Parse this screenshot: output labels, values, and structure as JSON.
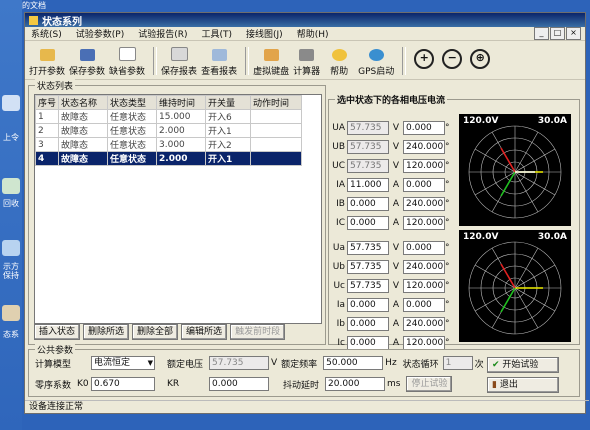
{
  "desktop": {
    "top_text": "的文档",
    "labels": [
      "上令",
      "回收",
      "示方保持",
      "态系"
    ]
  },
  "window": {
    "title": "状态系列",
    "controls": [
      "_",
      "□",
      "×"
    ]
  },
  "menu": [
    "系统(S)",
    "试验参数(P)",
    "试验报告(R)",
    "工具(T)",
    "接线图(J)",
    "帮助(H)"
  ],
  "toolbar": {
    "open": "打开参数",
    "save": "保存参数",
    "default": "缺省参数",
    "save_report": "保存报表",
    "view_report": "查看报表",
    "keyboard": "虚拟键盘",
    "calculator": "计算器",
    "help": "帮助",
    "gps": "GPS启动",
    "zoom_in": "+",
    "zoom_out": "−",
    "zoom_fit": "⊕"
  },
  "state_list": {
    "title": "状态列表",
    "headers": [
      "序号",
      "状态名称",
      "状态类型",
      "维持时间",
      "开关量",
      "动作时间"
    ],
    "rows": [
      [
        "1",
        "故障态",
        "任意状态",
        "15.000",
        "开入6",
        ""
      ],
      [
        "2",
        "故障态",
        "任意状态",
        "2.000",
        "开入1",
        ""
      ],
      [
        "3",
        "故障态",
        "任意状态",
        "3.000",
        "开入2",
        ""
      ],
      [
        "4",
        "故障态",
        "任意状态",
        "2.000",
        "开入1",
        ""
      ]
    ],
    "selected_index": 3,
    "buttons": [
      "插入状态",
      "删除所选",
      "删除全部",
      "编辑所选",
      "触发前时段"
    ]
  },
  "phasor": {
    "title": "选中状态下的各相电压电流",
    "set1": {
      "rows": [
        {
          "label": "UA",
          "mag": "57.735",
          "mag_unit": "V",
          "ang": "0.000",
          "ang_unit": "°"
        },
        {
          "label": "UB",
          "mag": "57.735",
          "mag_unit": "V",
          "ang": "240.000",
          "ang_unit": "°"
        },
        {
          "label": "UC",
          "mag": "57.735",
          "mag_unit": "V",
          "ang": "120.000",
          "ang_unit": "°"
        },
        {
          "label": "IA",
          "mag": "11.000",
          "mag_unit": "A",
          "ang": "0.000",
          "ang_unit": "°"
        },
        {
          "label": "IB",
          "mag": "0.000",
          "mag_unit": "A",
          "ang": "240.000",
          "ang_unit": "°"
        },
        {
          "label": "IC",
          "mag": "0.000",
          "mag_unit": "A",
          "ang": "120.000",
          "ang_unit": "°"
        }
      ],
      "scale_v": "120.0V",
      "scale_a": "30.0A"
    },
    "set2": {
      "rows": [
        {
          "label": "Ua",
          "mag": "57.735",
          "mag_unit": "V",
          "ang": "0.000",
          "ang_unit": "°"
        },
        {
          "label": "Ub",
          "mag": "57.735",
          "mag_unit": "V",
          "ang": "240.000",
          "ang_unit": "°"
        },
        {
          "label": "Uc",
          "mag": "57.735",
          "mag_unit": "V",
          "ang": "120.000",
          "ang_unit": "°"
        },
        {
          "label": "Ia",
          "mag": "0.000",
          "mag_unit": "A",
          "ang": "0.000",
          "ang_unit": "°"
        },
        {
          "label": "Ib",
          "mag": "0.000",
          "mag_unit": "A",
          "ang": "240.000",
          "ang_unit": "°"
        },
        {
          "label": "Ic",
          "mag": "0.000",
          "mag_unit": "A",
          "ang": "120.000",
          "ang_unit": "°"
        }
      ],
      "scale_v": "120.0V",
      "scale_a": "30.0A"
    }
  },
  "common": {
    "title": "公共参数",
    "calc_model_label": "计算模型",
    "calc_model_value": "电流恒定",
    "rated_v_label": "额定电压",
    "rated_v_value": "57.735",
    "rated_v_unit": "V",
    "rated_f_label": "额定频率",
    "rated_f_value": "50.000",
    "rated_f_unit": "Hz",
    "loop_label": "状态循环",
    "loop_value": "1",
    "loop_unit": "次",
    "zero_label": "零序系数",
    "k0_label": "K0",
    "k0_value": "0.670",
    "kr_label": "KR",
    "kr_value": "0.000",
    "debounce_label": "抖动延时",
    "debounce_value": "20.000",
    "debounce_unit": "ms",
    "start_btn": "开始试验",
    "exit_btn": "退出",
    "stop_btn": "停止试验"
  },
  "status_bar": "设备连接正常"
}
